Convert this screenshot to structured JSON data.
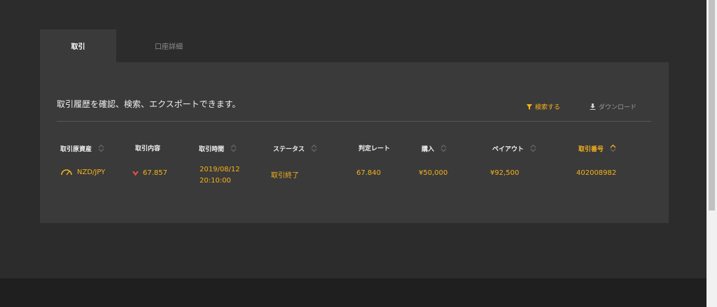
{
  "tabs": [
    {
      "label": "取引"
    },
    {
      "label": "口座詳細"
    }
  ],
  "panel": {
    "intro": "取引履歴を確認、検索、エクスポートできます。",
    "search_label": "検索する",
    "download_label": "ダウンロード"
  },
  "table": {
    "headers": [
      {
        "label": "取引原資産"
      },
      {
        "label": "取引内容"
      },
      {
        "label": "取引時間"
      },
      {
        "label": "ステータス"
      },
      {
        "label": "判定レート"
      },
      {
        "label": "購入"
      },
      {
        "label": "ペイアウト"
      },
      {
        "label": "取引番号"
      }
    ],
    "rows": [
      {
        "asset": "NZD/JPY",
        "content": "67.857",
        "date": "2019/08/12",
        "time": "20:10:00",
        "status": "取引終了",
        "rate": "67.840",
        "buy": "¥50,000",
        "payout": "¥92,500",
        "number": "402008982"
      }
    ]
  },
  "colors": {
    "accent": "#f5b21b",
    "down_arrow": "#e8533a",
    "panel_bg": "#3a3a3a",
    "page_bg": "#2c2c2c"
  },
  "icons": {
    "asset": "speedometer-icon",
    "content": "down-arrow-icon",
    "search": "filter-icon",
    "download": "download-icon",
    "sort": "sort-icon"
  }
}
